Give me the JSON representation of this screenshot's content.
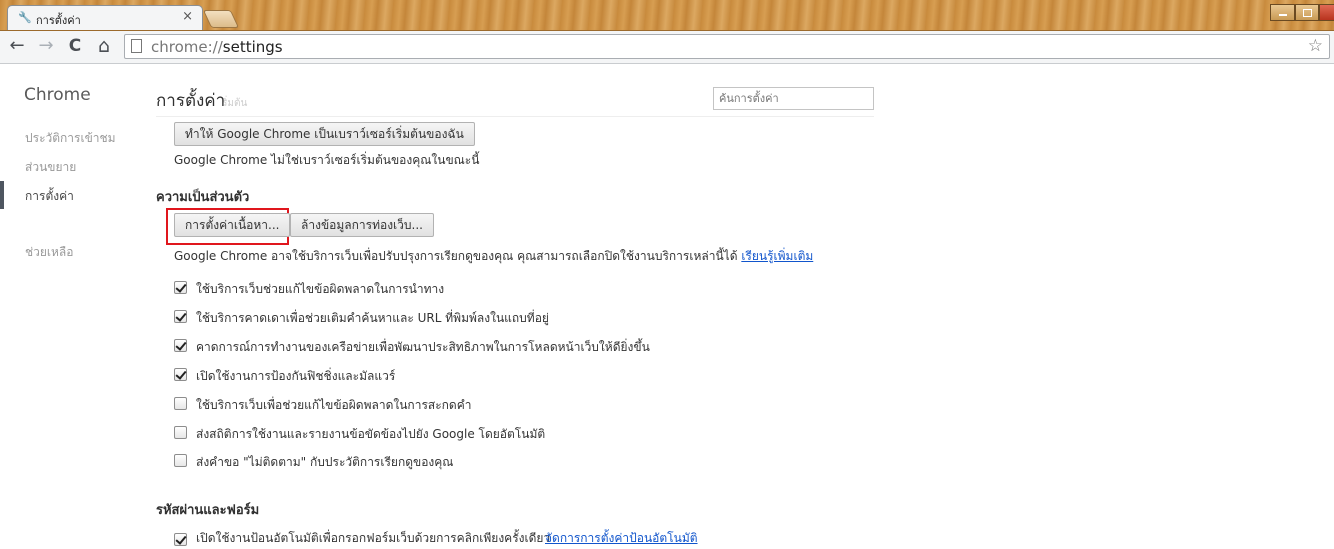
{
  "window": {
    "tab_title": "การตั้งค่า",
    "tab_close": "×"
  },
  "toolbar": {
    "url_scheme": "chrome://",
    "url_path": "settings",
    "back_icon": "←",
    "forward_icon": "→",
    "reload_icon": "C",
    "home_icon": "⌂",
    "star_icon": "☆"
  },
  "sidebar": {
    "brand": "Chrome",
    "items": [
      {
        "label": "ประวัติการเข้าชม"
      },
      {
        "label": "ส่วนขยาย"
      },
      {
        "label": "การตั้งค่า"
      },
      {
        "label": "ช่วยเหลือ"
      }
    ]
  },
  "main": {
    "title": "การตั้งค่า",
    "ghost_text": "ริ่มต้น",
    "search_placeholder": "ค้นการตั้งค่า",
    "default_browser": {
      "button": "ทำให้ Google Chrome เป็นเบราว์เซอร์เริ่มต้นของฉัน",
      "status": "Google Chrome ไม่ใช่เบราว์เซอร์เริ่มต้นของคุณในขณะนี้"
    },
    "privacy": {
      "heading": "ความเป็นส่วนตัว",
      "content_settings_button": "การตั้งค่าเนื้อหา...",
      "clear_data_button": "ล้างข้อมูลการท่องเว็บ...",
      "description": "Google Chrome อาจใช้บริการเว็บเพื่อปรับปรุงการเรียกดูของคุณ คุณสามารถเลือกปิดใช้งานบริการเหล่านี้ได้",
      "learn_more": "เรียนรู้เพิ่มเติม",
      "options": [
        {
          "label": "ใช้บริการเว็บช่วยแก้ไขข้อผิดพลาดในการนำทาง",
          "checked": true
        },
        {
          "label": "ใช้บริการคาดเดาเพื่อช่วยเติมคำค้นหาและ URL ที่พิมพ์ลงในแถบที่อยู่",
          "checked": true
        },
        {
          "label": "คาดการณ์การทำงานของเครือข่ายเพื่อพัฒนาประสิทธิภาพในการโหลดหน้าเว็บให้ดียิ่งขึ้น",
          "checked": true
        },
        {
          "label": "เปิดใช้งานการป้องกันฟิชชิ่งและมัลแวร์",
          "checked": true
        },
        {
          "label": "ใช้บริการเว็บเพื่อช่วยแก้ไขข้อผิดพลาดในการสะกดคำ",
          "checked": false
        },
        {
          "label": "ส่งสถิติการใช้งานและรายงานข้อขัดข้องไปยัง Google โดยอัตโนมัติ",
          "checked": false
        },
        {
          "label": "ส่งคำขอ \"ไม่ติดตาม\" กับประวัติการเรียกดูของคุณ",
          "checked": false
        }
      ]
    },
    "passwords": {
      "heading": "รหัสผ่านและฟอร์ม",
      "first_option": "เปิดใช้งานป้อนอัตโนมัติเพื่อกรอกฟอร์มเว็บด้วยการคลิกเพียงครั้งเดียว",
      "first_option_link": "จัดการการตั้งค่าป้อนอัตโนมัติ",
      "first_checked": true
    }
  }
}
